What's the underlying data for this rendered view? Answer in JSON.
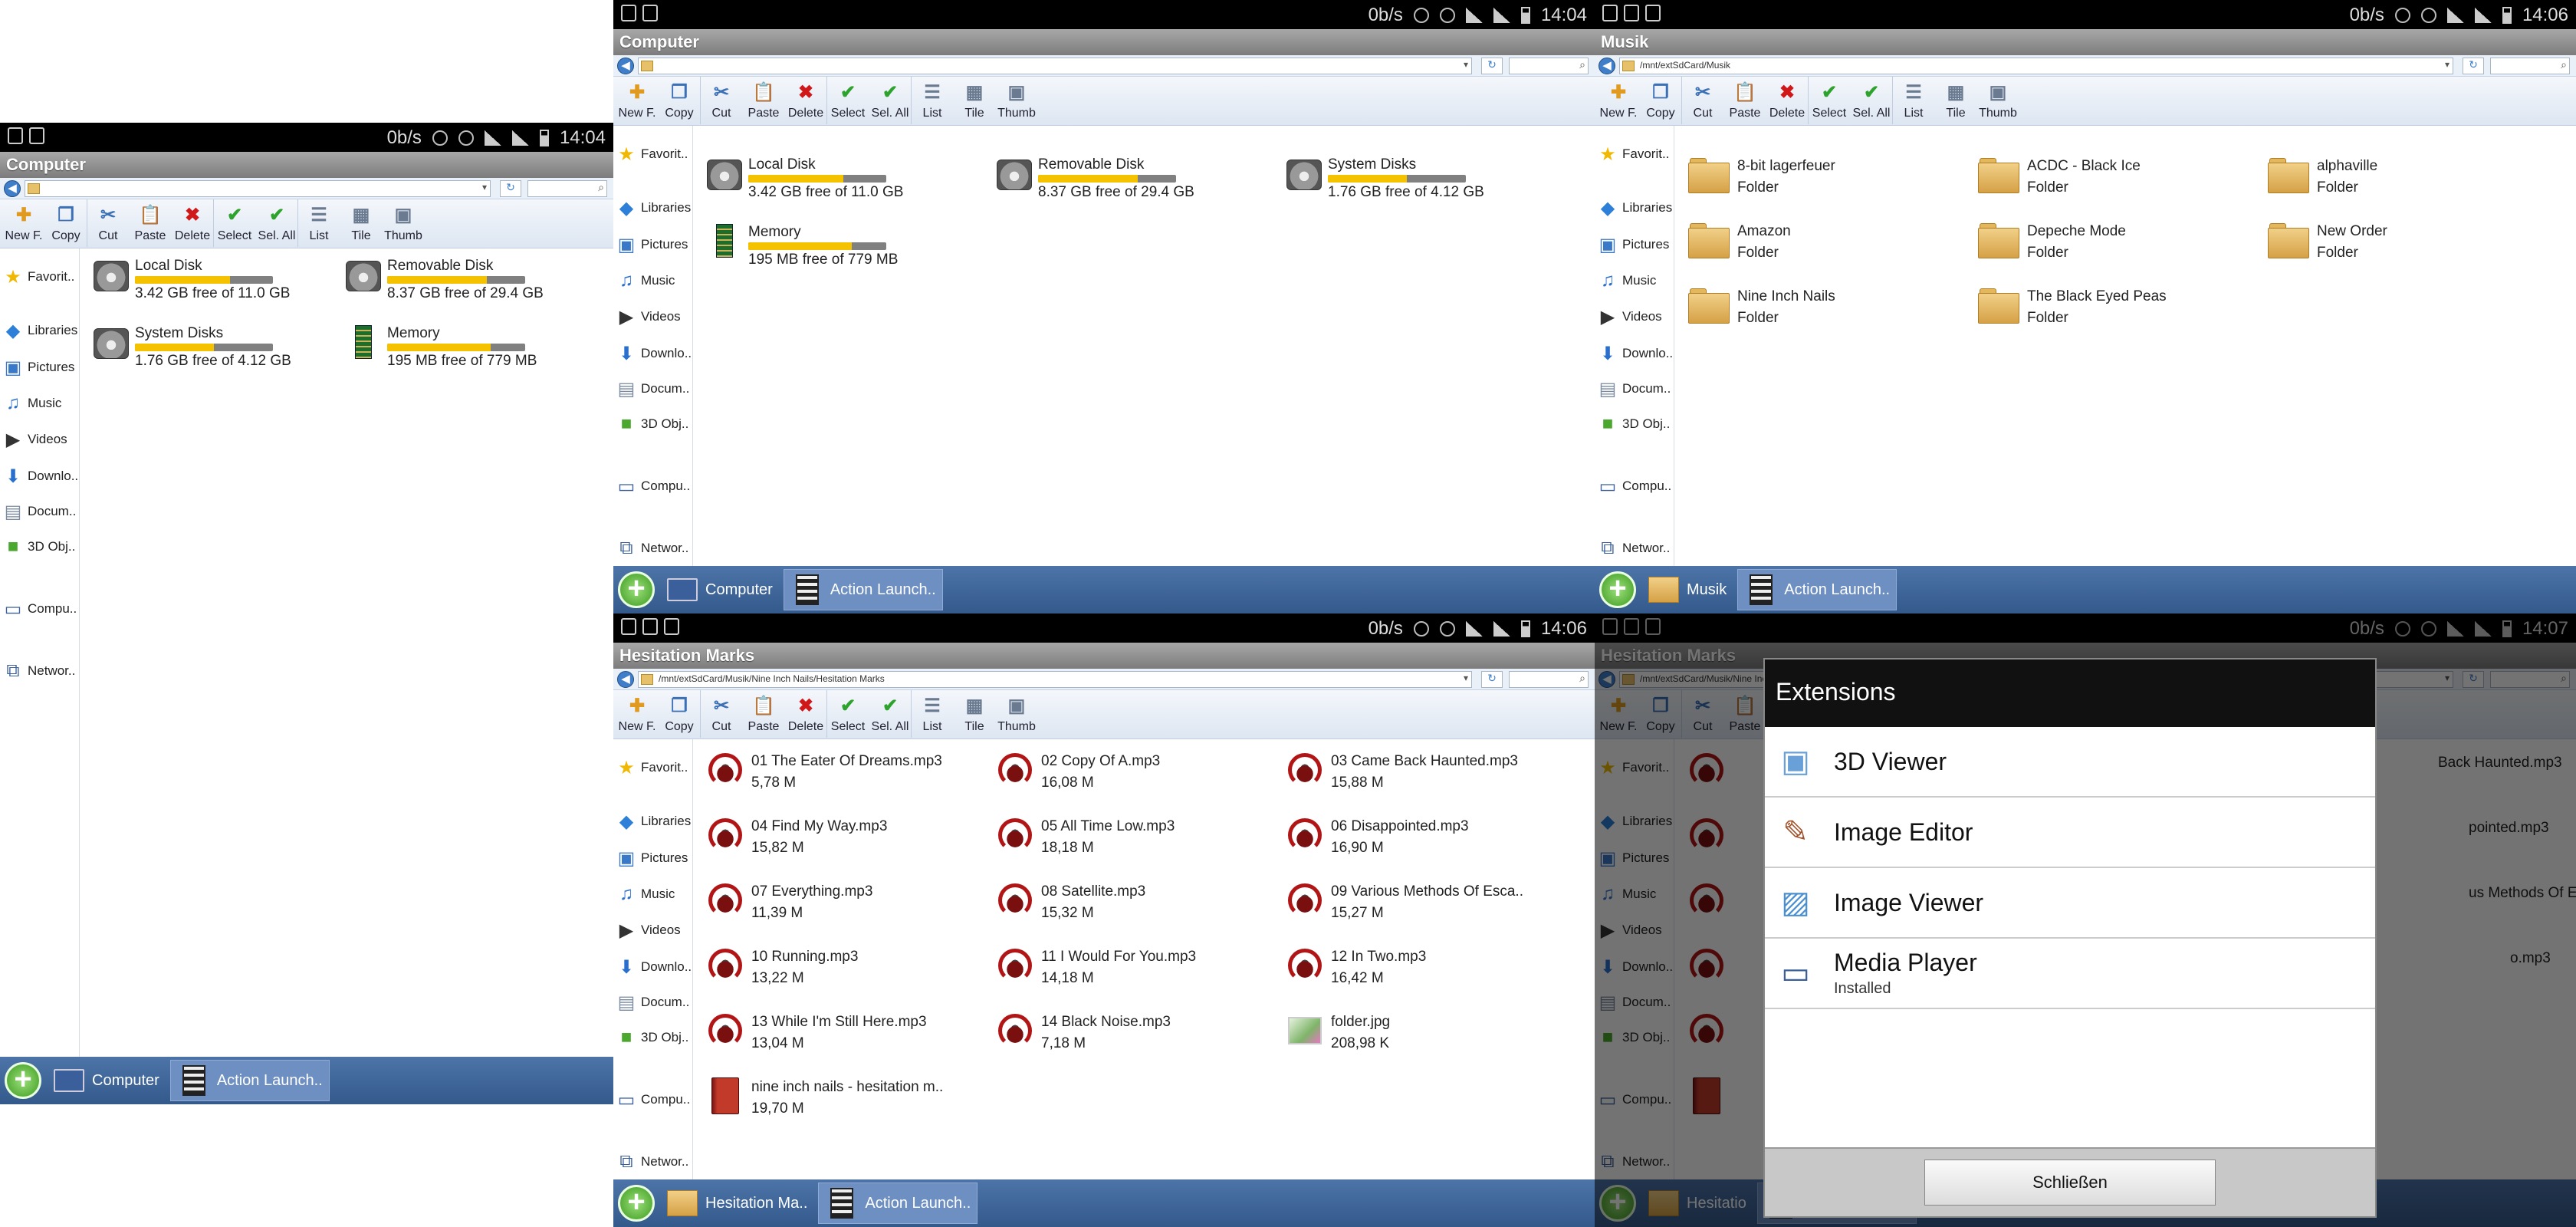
{
  "status": {
    "speed": "0b/s",
    "times": [
      "14:04",
      "14:04",
      "14:06",
      "14:06",
      "14:07"
    ]
  },
  "toolbar": {
    "buttons": [
      "New F.",
      "Copy",
      "Cut",
      "Paste",
      "Delete",
      "Select",
      "Sel. All",
      "List",
      "Tile",
      "Thumb"
    ]
  },
  "sidebar": {
    "items": [
      "Favorit..",
      "Libraries",
      "Pictures",
      "Music",
      "Videos",
      "Downlo..",
      "Docum..",
      "3D Obj..",
      "Compu..",
      "Networ.."
    ]
  },
  "taskbar": {
    "action_label": "Action Launch.."
  },
  "screen1": {
    "title": "Computer",
    "path": "",
    "task_label": "Computer",
    "drives": [
      {
        "name": "Local Disk",
        "info": "3.42 GB free of 11.0 GB",
        "used": 0.69,
        "type": "hdd"
      },
      {
        "name": "Removable Disk",
        "info": "8.37 GB free of 29.4 GB",
        "used": 0.72,
        "type": "hdd"
      },
      {
        "name": "System Disks",
        "info": "1.76 GB free of 4.12 GB",
        "used": 0.57,
        "type": "hdd"
      },
      {
        "name": "Memory",
        "info": "195 MB free of 779 MB",
        "used": 0.75,
        "type": "ram"
      }
    ]
  },
  "screen2": {
    "title": "Computer",
    "path": "",
    "task_label": "Computer"
  },
  "screen3": {
    "title": "Musik",
    "path": "/mnt/extSdCard/Musik",
    "task_label": "Musik",
    "folder_sub": "Folder",
    "folders": [
      "8-bit lagerfeuer",
      "ACDC - Black Ice",
      "alphaville",
      "Amazon",
      "Depeche Mode",
      "New Order",
      "Nine Inch Nails",
      "The Black Eyed Peas"
    ]
  },
  "screen4": {
    "title": "Hesitation Marks",
    "path": "/mnt/extSdCard/Musik/Nine Inch Nails/Hesitation Marks",
    "task_label": "Hesitation Ma..",
    "files": [
      {
        "name": "01 The Eater Of Dreams.mp3",
        "size": "5,78 M",
        "kind": "audio"
      },
      {
        "name": "02 Copy Of A.mp3",
        "size": "16,08 M",
        "kind": "audio"
      },
      {
        "name": "03 Came Back Haunted.mp3",
        "size": "15,88 M",
        "kind": "audio"
      },
      {
        "name": "04 Find My Way.mp3",
        "size": "15,82 M",
        "kind": "audio"
      },
      {
        "name": "05 All Time Low.mp3",
        "size": "18,18 M",
        "kind": "audio"
      },
      {
        "name": "06 Disappointed.mp3",
        "size": "16,90 M",
        "kind": "audio"
      },
      {
        "name": "07 Everything.mp3",
        "size": "11,39 M",
        "kind": "audio"
      },
      {
        "name": "08 Satellite.mp3",
        "size": "15,32 M",
        "kind": "audio"
      },
      {
        "name": "09 Various Methods Of Esca..",
        "size": "15,27 M",
        "kind": "audio"
      },
      {
        "name": "10 Running.mp3",
        "size": "13,22 M",
        "kind": "audio"
      },
      {
        "name": "11 I Would For You.mp3",
        "size": "14,18 M",
        "kind": "audio"
      },
      {
        "name": "12 In Two.mp3",
        "size": "16,42 M",
        "kind": "audio"
      },
      {
        "name": "13 While I'm Still Here.mp3",
        "size": "13,04 M",
        "kind": "audio"
      },
      {
        "name": "14 Black Noise.mp3",
        "size": "7,18 M",
        "kind": "audio"
      },
      {
        "name": "folder.jpg",
        "size": "208,98 K",
        "kind": "image"
      },
      {
        "name": "nine inch nails - hesitation m..",
        "size": "19,70 M",
        "kind": "book"
      }
    ]
  },
  "screen5": {
    "title": "Hesitation Marks",
    "path": "/mnt/extSdCard/Musik/Nine Inch",
    "task_label": "Hesitatio",
    "ghost_files": [
      "Back Haunted.mp3",
      "pointed.mp3",
      "us Methods Of Esca..",
      "o.mp3"
    ],
    "dialog": {
      "title": "Extensions",
      "items": [
        {
          "name": "3D Viewer",
          "sub": ""
        },
        {
          "name": "Image Editor",
          "sub": ""
        },
        {
          "name": "Image Viewer",
          "sub": ""
        },
        {
          "name": "Media Player",
          "sub": "Installed"
        }
      ],
      "close_label": "Schließen"
    }
  }
}
